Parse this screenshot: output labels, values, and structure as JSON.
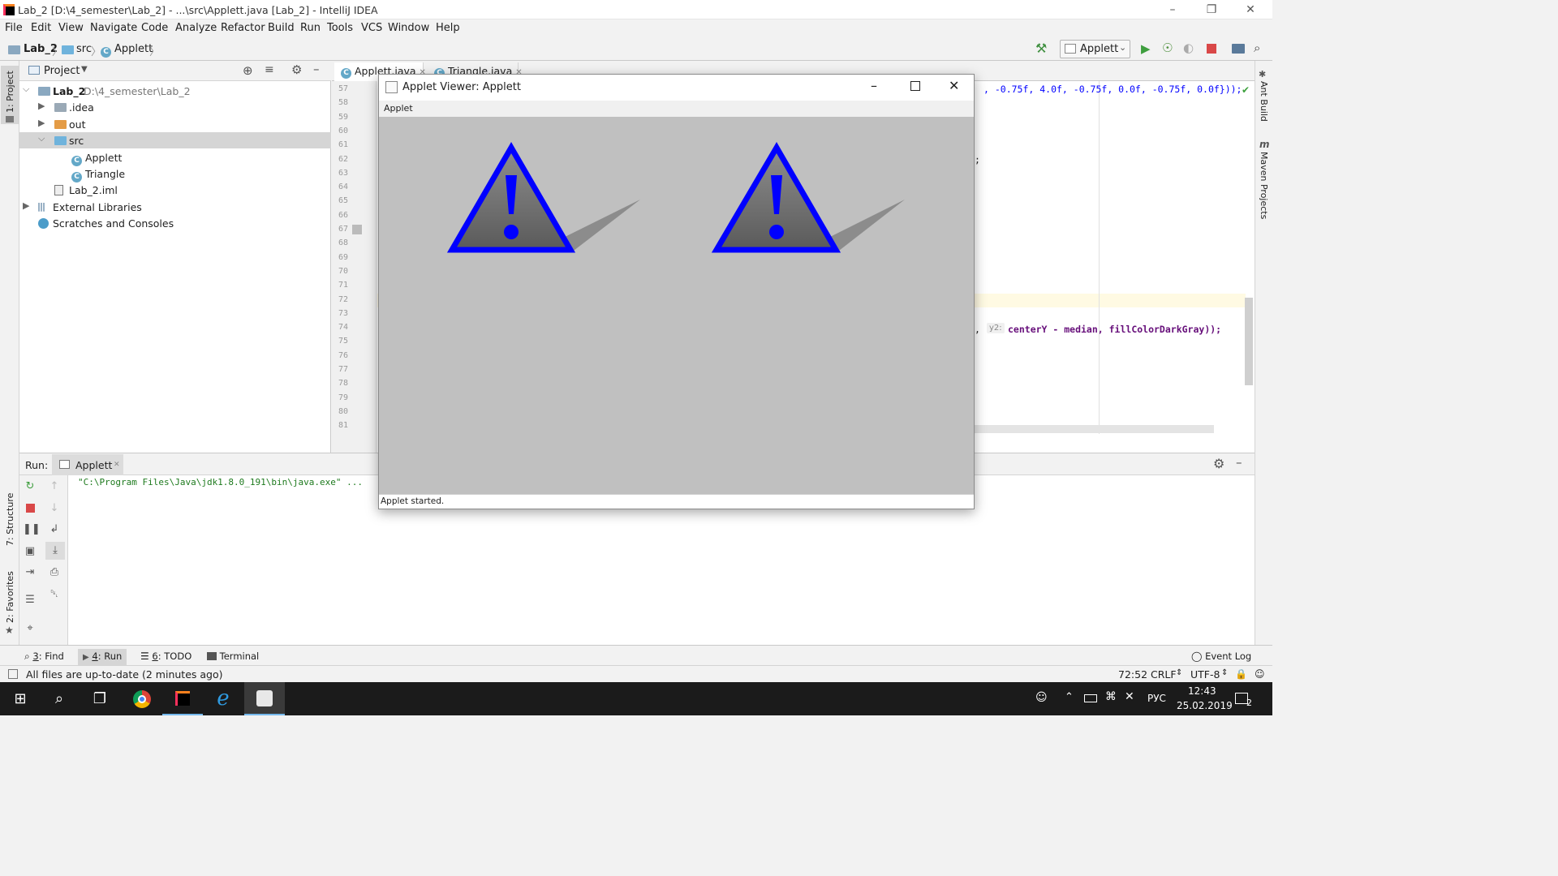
{
  "window": {
    "title": "Lab_2 [D:\\4_semester\\Lab_2] - ...\\src\\Applett.java [Lab_2] - IntelliJ IDEA"
  },
  "menu": [
    "File",
    "Edit",
    "View",
    "Navigate",
    "Code",
    "Analyze",
    "Refactor",
    "Build",
    "Run",
    "Tools",
    "VCS",
    "Window",
    "Help"
  ],
  "breadcrumb": {
    "project": "Lab_2",
    "folder": "src",
    "file": "Applett"
  },
  "toolbar": {
    "run_config": "Applett"
  },
  "sidebar": {
    "left_project": "1: Project",
    "left_structure": "7: Structure",
    "left_favorites": "2: Favorites",
    "right_ant": "Ant Build",
    "right_maven": "Maven Projects"
  },
  "project_panel": {
    "title": "Project",
    "tree": [
      {
        "label": "Lab_2",
        "path": "D:\\4_semester\\Lab_2"
      },
      {
        "label": ".idea"
      },
      {
        "label": "out"
      },
      {
        "label": "src"
      },
      {
        "label": "Applett"
      },
      {
        "label": "Triangle"
      },
      {
        "label": "Lab_2.iml"
      },
      {
        "label": "External Libraries"
      },
      {
        "label": "Scratches and Consoles"
      }
    ]
  },
  "editor": {
    "tabs": [
      "Applett.java",
      "Triangle.java"
    ],
    "line_numbers": [
      "57",
      "58",
      "59",
      "60",
      "61",
      "62",
      "63",
      "64",
      "65",
      "66",
      "67",
      "68",
      "69",
      "70",
      "71",
      "72",
      "73",
      "74",
      "75",
      "76",
      "77",
      "78",
      "79",
      "80",
      "81"
    ],
    "code_line_57": ", -0.75f, 4.0f, -0.75f, 0.0f, -0.75f, 0.0f}));",
    "code_line_62": ";",
    "code_line_74_prefix": ",",
    "code_line_74_hint": "y2:",
    "code_line_74": "centerY - median, fillColorDarkGray));"
  },
  "applet": {
    "title": "Applet Viewer: Applett",
    "menu": "Applet",
    "status": "Applet started.",
    "colors": {
      "canvas": "#c0c0c0",
      "triangle_stroke": "#0000ff",
      "shadow": "#8c8c8c"
    }
  },
  "run_panel": {
    "label": "Run:",
    "tab": "Applett",
    "output": "\"C:\\Program Files\\Java\\jdk1.8.0_191\\bin\\java.exe\" ..."
  },
  "bottom_tabs": [
    {
      "num": "3",
      "label": ": Find"
    },
    {
      "num": "4",
      "label": ": Run"
    },
    {
      "num": "6",
      "label": ": TODO"
    },
    {
      "num": "",
      "label": "Terminal"
    }
  ],
  "event_log": "Event Log",
  "status": {
    "message": "All files are up-to-date (2 minutes ago)",
    "position": "72:52",
    "line_sep": "CRLF",
    "encoding": "UTF-8"
  },
  "taskbar": {
    "lang": "РУС",
    "time": "12:43",
    "date": "25.02.2019",
    "notifications": "2"
  }
}
